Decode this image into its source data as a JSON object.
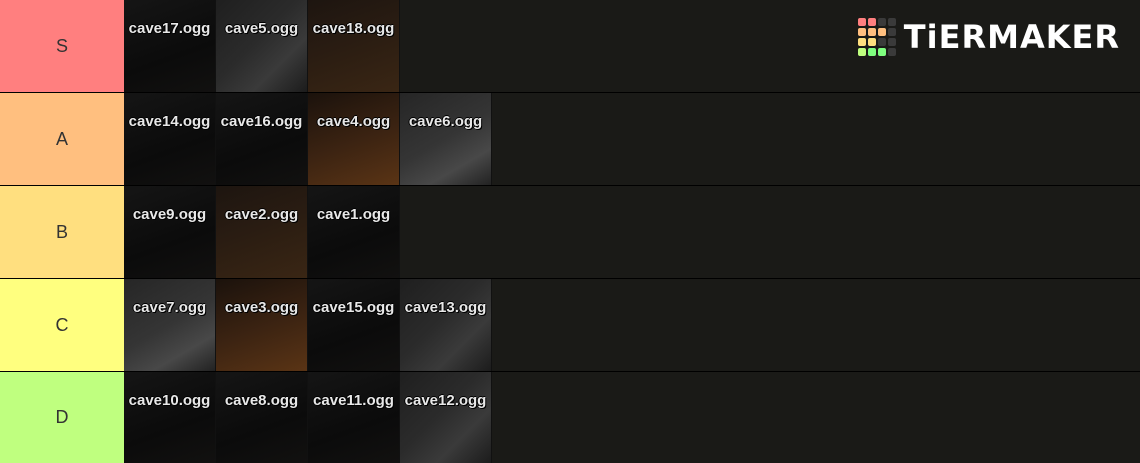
{
  "logo": {
    "text": "TiERMAKER",
    "grid_colors": [
      "#ff7f7f",
      "#ff7f7f",
      "#3a3a3a",
      "#3a3a3a",
      "#ffbf7f",
      "#ffbf7f",
      "#ffbf7f",
      "#3a3a3a",
      "#ffdf7f",
      "#ffdf7f",
      "#3a3a3a",
      "#3a3a3a",
      "#bfff7f",
      "#7fff7f",
      "#7fff7f",
      "#3a3a3a"
    ]
  },
  "tiers": [
    {
      "label": "S",
      "color": "#ff7f7f",
      "items": [
        {
          "name": "cave17.ogg",
          "texture": "dark"
        },
        {
          "name": "cave5.ogg",
          "texture": "stone"
        },
        {
          "name": "cave18.ogg",
          "texture": "brown"
        }
      ]
    },
    {
      "label": "A",
      "color": "#ffbf7f",
      "items": [
        {
          "name": "cave14.ogg",
          "texture": "dark"
        },
        {
          "name": "cave16.ogg",
          "texture": "dark"
        },
        {
          "name": "cave4.ogg",
          "texture": "lava"
        },
        {
          "name": "cave6.ogg",
          "texture": "grey"
        }
      ]
    },
    {
      "label": "B",
      "color": "#ffdf7f",
      "items": [
        {
          "name": "cave9.ogg",
          "texture": "dark"
        },
        {
          "name": "cave2.ogg",
          "texture": "brown"
        },
        {
          "name": "cave1.ogg",
          "texture": "dark"
        }
      ]
    },
    {
      "label": "C",
      "color": "#ffff7f",
      "items": [
        {
          "name": "cave7.ogg",
          "texture": "grey"
        },
        {
          "name": "cave3.ogg",
          "texture": "lava"
        },
        {
          "name": "cave15.ogg",
          "texture": "dark"
        },
        {
          "name": "cave13.ogg",
          "texture": "stone"
        }
      ]
    },
    {
      "label": "D",
      "color": "#bfff7f",
      "items": [
        {
          "name": "cave10.ogg",
          "texture": "dark"
        },
        {
          "name": "cave8.ogg",
          "texture": "dark"
        },
        {
          "name": "cave11.ogg",
          "texture": "dark"
        },
        {
          "name": "cave12.ogg",
          "texture": "stone"
        }
      ]
    }
  ]
}
